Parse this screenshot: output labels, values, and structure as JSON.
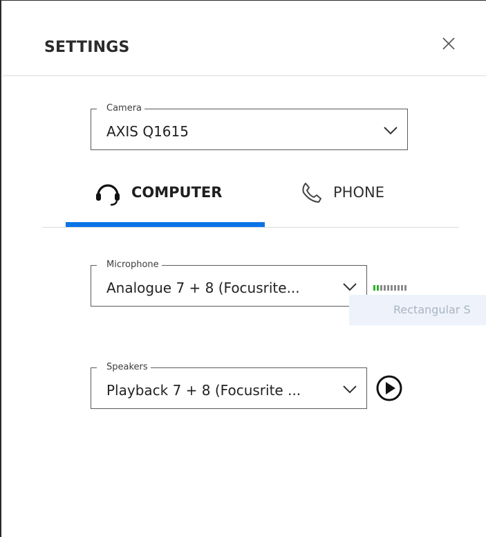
{
  "header": {
    "title": "SETTINGS"
  },
  "camera": {
    "label": "Camera",
    "value": "AXIS Q1615"
  },
  "tabs": [
    {
      "label": "COMPUTER",
      "icon": "headset-icon",
      "selected": true
    },
    {
      "label": "PHONE",
      "icon": "phone-icon",
      "selected": false
    }
  ],
  "microphone": {
    "label": "Microphone",
    "value": "Analogue 7 + 8 (Focusrite...",
    "level_fraction": 0.15
  },
  "tooltip": {
    "text": "Rectangular S"
  },
  "speakers": {
    "label": "Speakers",
    "value": "Playback 7 + 8 (Focusrite ..."
  },
  "colors": {
    "accent": "#0a74e6",
    "meter_active": "#28b428"
  }
}
